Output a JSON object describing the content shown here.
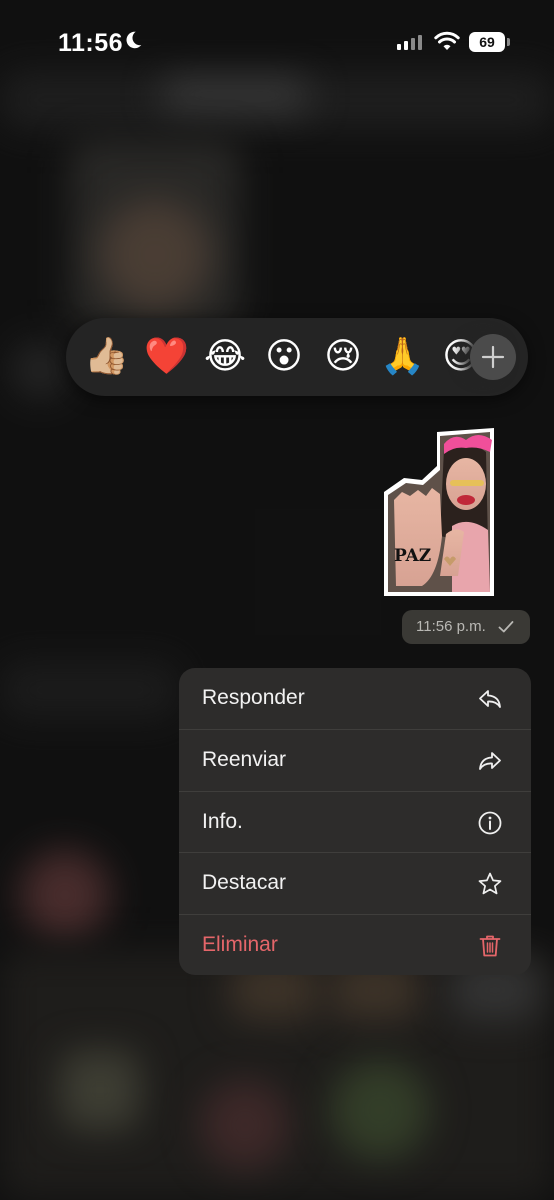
{
  "status_bar": {
    "time": "11:56",
    "battery_level": "69",
    "focus_icon": "moon-icon",
    "signal_icon": "cellular-signal-icon",
    "wifi_icon": "wifi-icon"
  },
  "reactions": {
    "emojis": [
      "👍🏼",
      "❤️",
      "😂",
      "😮",
      "😢",
      "🙏",
      "😍"
    ],
    "more_icon": "plus-icon"
  },
  "message": {
    "sticker_text": "PAZ",
    "timestamp": "11:56 p.m.",
    "status_icon": "check-icon"
  },
  "context_menu": {
    "items": [
      {
        "label": "Responder",
        "icon": "reply-icon"
      },
      {
        "label": "Reenviar",
        "icon": "forward-icon"
      },
      {
        "label": "Info.",
        "icon": "info-icon"
      },
      {
        "label": "Destacar",
        "icon": "star-icon"
      },
      {
        "label": "Eliminar",
        "icon": "trash-icon",
        "color": "#e5666a"
      }
    ]
  },
  "colors": {
    "menu_background": "#2d2c2b",
    "destructive": "#e5666a",
    "reaction_bar": "#242424"
  }
}
